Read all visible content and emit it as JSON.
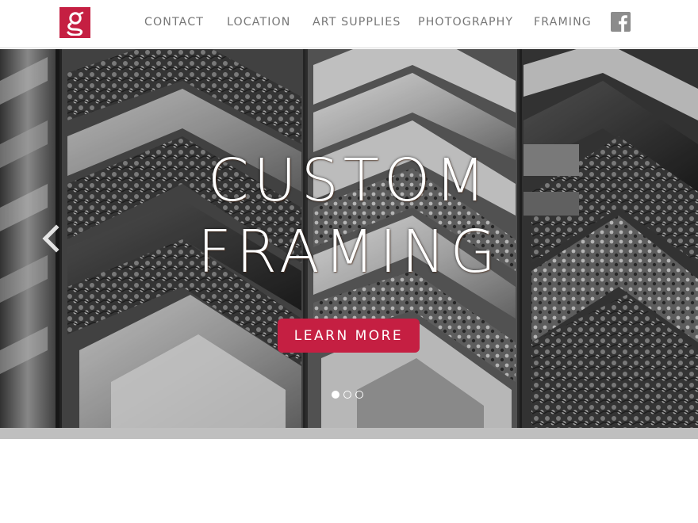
{
  "brand": {
    "logo_letter": "g",
    "logo_color": "#c51f42"
  },
  "nav": {
    "items": [
      {
        "label": "CONTACT"
      },
      {
        "label": "LOCATION"
      },
      {
        "label": "ART SUPPLIES"
      },
      {
        "label": "PHOTOGRAPHY"
      },
      {
        "label": "FRAMING"
      }
    ],
    "social_icon": "facebook-icon"
  },
  "hero": {
    "title_line_1": "CUSTOM",
    "title_line_2": "FRAMING",
    "cta_label": "LEARN MORE",
    "cta_color": "#c51f42",
    "prev_icon": "chevron-left-icon",
    "slides": [
      {
        "active": true
      },
      {
        "active": false
      },
      {
        "active": false
      }
    ]
  }
}
